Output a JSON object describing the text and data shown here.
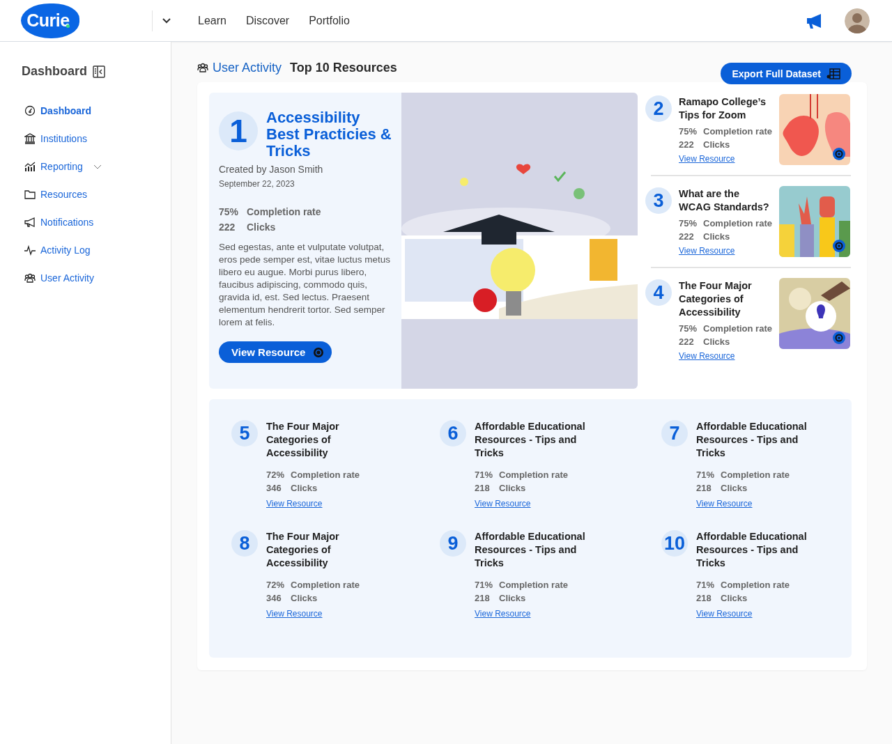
{
  "header": {
    "logo": "Curie",
    "nav": [
      {
        "label": "Learn"
      },
      {
        "label": "Discover"
      },
      {
        "label": "Portfolio"
      }
    ]
  },
  "sidebar": {
    "title": "Dashboard",
    "items": [
      {
        "label": "Dashboard",
        "kind": "gauge",
        "selected": true,
        "expandable": false
      },
      {
        "label": "Institutions",
        "kind": "bank",
        "selected": false,
        "expandable": false
      },
      {
        "label": "Reporting",
        "kind": "chart",
        "selected": false,
        "expandable": true
      },
      {
        "label": "Resources",
        "kind": "folder",
        "selected": false,
        "expandable": false
      },
      {
        "label": "Notifications",
        "kind": "megaphone",
        "selected": false,
        "expandable": false
      },
      {
        "label": "Activity Log",
        "kind": "pulse",
        "selected": false,
        "expandable": false
      },
      {
        "label": "User Activity",
        "kind": "users",
        "selected": false,
        "expandable": false
      }
    ]
  },
  "page": {
    "breadcrumb": "User Activity",
    "title": "Top 10 Resources",
    "export_button": "Export Full Dataset"
  },
  "featured": {
    "rank": "1",
    "title": "Accessibility Best Practicies & Tricks",
    "author": "Created by Jason Smith",
    "date": "September 22, 2023",
    "completion": "75%",
    "completion_label": "Completion rate",
    "clicks": "222",
    "clicks_label": "Clicks",
    "description": "Sed egestas, ante et vulputate volutpat, eros pede semper est, vitae luctus metus libero eu augue. Morbi purus libero, faucibus adipiscing, commodo quis, gravida id, est. Sed lectus. Praesent elementum hendrerit tortor. Sed semper lorem at felis.",
    "button": "View Resource"
  },
  "side_resources": [
    {
      "rank": "2",
      "title": "Ramapo College’s Tips for Zoom",
      "completion": "75%",
      "completion_label": "Completion rate",
      "clicks": "222",
      "clicks_label": "Clicks",
      "link": "View Resource",
      "kind": "abstract"
    },
    {
      "rank": "3",
      "title": "What are the WCAG Standards?",
      "completion": "75%",
      "completion_label": "Completion rate",
      "clicks": "222",
      "clicks_label": "Clicks",
      "link": "View Resource",
      "kind": "hands"
    },
    {
      "rank": "4",
      "title": "The Four Major Categories of Accessibility",
      "completion": "75%",
      "completion_label": "Completion rate",
      "clicks": "222",
      "clicks_label": "Clicks",
      "link": "View Resource",
      "kind": "lightbulb"
    }
  ],
  "grid_resources": [
    {
      "rank": "5",
      "title": "The Four Major Categories of Accessibility",
      "completion": "72%",
      "completion_label": "Completion rate",
      "clicks": "346",
      "clicks_label": "Clicks",
      "link": "View Resource"
    },
    {
      "rank": "6",
      "title": "Affordable Educational Resources - Tips and Tricks",
      "completion": "71%",
      "completion_label": "Completion rate",
      "clicks": "218",
      "clicks_label": "Clicks",
      "link": "View Resource"
    },
    {
      "rank": "7",
      "title": "Affordable Educational Resources - Tips and Tricks",
      "completion": "71%",
      "completion_label": "Completion rate",
      "clicks": "218",
      "clicks_label": "Clicks",
      "link": "View Resource"
    },
    {
      "rank": "8",
      "title": "The Four Major Categories of Accessibility",
      "completion": "72%",
      "completion_label": "Completion rate",
      "clicks": "346",
      "clicks_label": "Clicks",
      "link": "View Resource"
    },
    {
      "rank": "9",
      "title": "Affordable Educational Resources - Tips and Tricks",
      "completion": "71%",
      "completion_label": "Completion rate",
      "clicks": "218",
      "clicks_label": "Clicks",
      "link": "View Resource"
    },
    {
      "rank": "10",
      "title": "Affordable Educational Resources - Tips and Tricks",
      "completion": "71%",
      "completion_label": "Completion rate",
      "clicks": "218",
      "clicks_label": "Clicks",
      "link": "View Resource"
    }
  ]
}
